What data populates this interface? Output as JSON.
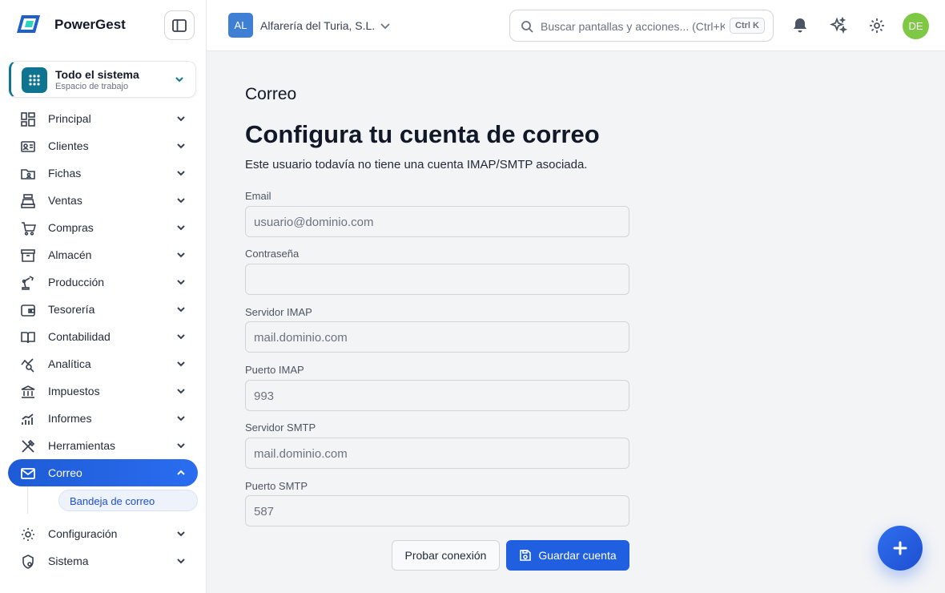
{
  "app": {
    "name": "PowerGest"
  },
  "workspace": {
    "title": "Todo el sistema",
    "subtitle": "Espacio de trabajo"
  },
  "sidebar": {
    "items": [
      {
        "label": "Principal",
        "icon": "dashboard-icon"
      },
      {
        "label": "Clientes",
        "icon": "contact-card-icon"
      },
      {
        "label": "Fichas",
        "icon": "folder-user-icon"
      },
      {
        "label": "Ventas",
        "icon": "cash-register-icon"
      },
      {
        "label": "Compras",
        "icon": "cart-icon"
      },
      {
        "label": "Almacén",
        "icon": "archive-box-icon"
      },
      {
        "label": "Producción",
        "icon": "robot-arm-icon"
      },
      {
        "label": "Tesorería",
        "icon": "wallet-icon"
      },
      {
        "label": "Contabilidad",
        "icon": "book-icon"
      },
      {
        "label": "Analítica",
        "icon": "chart-search-icon"
      },
      {
        "label": "Impuestos",
        "icon": "bank-icon"
      },
      {
        "label": "Informes",
        "icon": "bar-chart-icon"
      },
      {
        "label": "Herramientas",
        "icon": "tools-icon"
      },
      {
        "label": "Correo",
        "icon": "mail-icon",
        "active": true
      },
      {
        "label": "Configuración",
        "icon": "gear-icon"
      },
      {
        "label": "Sistema",
        "icon": "shield-gear-icon"
      }
    ],
    "subitem": "Bandeja de correo"
  },
  "topbar": {
    "company_initials": "AL",
    "company_name": "Alfarería del Turia, S.L.",
    "search_placeholder": "Buscar pantallas y acciones... (Ctrl+K)",
    "search_shortcut": "Ctrl K",
    "avatar_initials": "DE"
  },
  "main": {
    "eyebrow": "Correo",
    "title": "Configura tu cuenta de correo",
    "description": "Este usuario todavía no tiene una cuenta IMAP/SMTP asociada.",
    "fields": [
      {
        "label": "Email",
        "placeholder": "usuario@dominio.com"
      },
      {
        "label": "Contraseña",
        "placeholder": ""
      },
      {
        "label": "Servidor IMAP",
        "placeholder": "mail.dominio.com"
      },
      {
        "label": "Puerto IMAP",
        "placeholder": "993"
      },
      {
        "label": "Servidor SMTP",
        "placeholder": "mail.dominio.com"
      },
      {
        "label": "Puerto SMTP",
        "placeholder": "587"
      }
    ],
    "test_button": "Probar conexión",
    "save_button": "Guardar cuenta"
  },
  "colors": {
    "accent": "#1f5fe0",
    "workspace": "#0e7490",
    "avatar": "#7ec845"
  }
}
